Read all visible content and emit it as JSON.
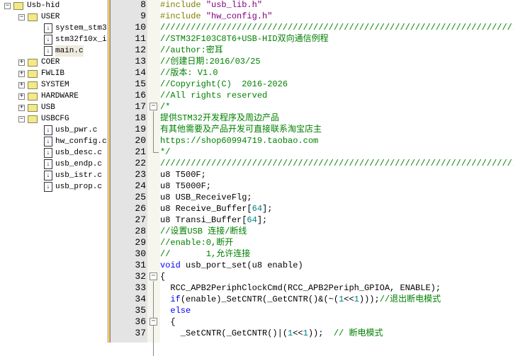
{
  "project_tree": {
    "root": "Usb-hid",
    "groups": [
      {
        "name": "USER",
        "expanded": true,
        "files": [
          "system_stm3",
          "stm32f10x_i",
          "main.c"
        ],
        "selected": "main.c"
      },
      {
        "name": "COER",
        "expanded": false
      },
      {
        "name": "FWLIB",
        "expanded": false
      },
      {
        "name": "SYSTEM",
        "expanded": false
      },
      {
        "name": "HARDWARE",
        "expanded": false
      },
      {
        "name": "USB",
        "expanded": false
      },
      {
        "name": "USBCFG",
        "expanded": true,
        "files": [
          "usb_pwr.c",
          "hw_config.c",
          "usb_desc.c",
          "usb_endp.c",
          "usb_istr.c",
          "usb_prop.c"
        ]
      }
    ]
  },
  "editor": {
    "lines": [
      {
        "n": "8",
        "seg": [
          [
            "#include ",
            "pp"
          ],
          [
            "\"usb_lib.h\"",
            "str"
          ]
        ]
      },
      {
        "n": "9",
        "seg": [
          [
            "#include ",
            "pp"
          ],
          [
            "\"hw_config.h\"",
            "str"
          ]
        ]
      },
      {
        "n": "10",
        "seg": [
          [
            "//////////////////////////////////////////////////////////////////////",
            "cm"
          ]
        ]
      },
      {
        "n": "11",
        "seg": [
          [
            "//STM32F103C8T6+USB-HID双向通信例程",
            "cm"
          ]
        ]
      },
      {
        "n": "12",
        "seg": [
          [
            "//author:密耳",
            "cm"
          ]
        ]
      },
      {
        "n": "13",
        "seg": [
          [
            "//创建日期:2016/03/25",
            "cm"
          ]
        ]
      },
      {
        "n": "14",
        "seg": [
          [
            "//版本: V1.0",
            "cm"
          ]
        ]
      },
      {
        "n": "15",
        "seg": [
          [
            "//Copyright(C)  2016-2026",
            "cm"
          ]
        ]
      },
      {
        "n": "16",
        "seg": [
          [
            "//All rights reserved",
            "cm"
          ]
        ]
      },
      {
        "n": "17",
        "seg": [
          [
            "/*",
            "cm"
          ]
        ],
        "fold": "start"
      },
      {
        "n": "18",
        "seg": [
          [
            "提供STM32开发程序及周边产品",
            "cm"
          ]
        ]
      },
      {
        "n": "19",
        "seg": [
          [
            "有其他需要及产品开发可直接联系淘宝店主",
            "cm"
          ]
        ]
      },
      {
        "n": "20",
        "seg": [
          [
            "https://shop60994719.taobao.com",
            "cm"
          ]
        ]
      },
      {
        "n": "21",
        "seg": [
          [
            "*/",
            "cm"
          ]
        ],
        "fold": "end"
      },
      {
        "n": "22",
        "seg": [
          [
            "//////////////////////////////////////////////////////////////////////",
            "cm"
          ]
        ]
      },
      {
        "n": "23",
        "seg": [
          [
            "u8 T500F;",
            "tx"
          ]
        ]
      },
      {
        "n": "24",
        "seg": [
          [
            "u8 T5000F;",
            "tx"
          ]
        ]
      },
      {
        "n": "25",
        "seg": [
          [
            "u8 USB_ReceiveFlg;",
            "tx"
          ]
        ]
      },
      {
        "n": "26",
        "seg": [
          [
            "u8 Receive_Buffer[",
            "tx"
          ],
          [
            "64",
            "num"
          ],
          [
            "];",
            "tx"
          ]
        ]
      },
      {
        "n": "27",
        "seg": [
          [
            "u8 Transi_Buffer[",
            "tx"
          ],
          [
            "64",
            "num"
          ],
          [
            "];",
            "tx"
          ]
        ]
      },
      {
        "n": "28",
        "seg": [
          [
            "//设置USB 连接/断线",
            "cm"
          ]
        ]
      },
      {
        "n": "29",
        "seg": [
          [
            "//enable:0,断开",
            "cm"
          ]
        ]
      },
      {
        "n": "30",
        "seg": [
          [
            "//       1,允许连接",
            "cm"
          ]
        ]
      },
      {
        "n": "31",
        "seg": [
          [
            "void",
            "kw"
          ],
          [
            " usb_port_set(u8 enable)",
            "tx"
          ]
        ]
      },
      {
        "n": "32",
        "seg": [
          [
            "{",
            "tx"
          ]
        ],
        "fold": "start"
      },
      {
        "n": "33",
        "seg": [
          [
            "  RCC_APB2PeriphClockCmd(RCC_APB2Periph_GPIOA, ENABLE);",
            "tx"
          ]
        ]
      },
      {
        "n": "34",
        "seg": [
          [
            "  ",
            "tx"
          ],
          [
            "if",
            "kw"
          ],
          [
            "(enable)_SetCNTR(_GetCNTR()&(~(",
            "tx"
          ],
          [
            "1",
            "num"
          ],
          [
            "<<",
            "tx"
          ],
          [
            "1",
            "num"
          ],
          [
            ")));",
            "tx"
          ],
          [
            "//退出断电模式",
            "cm"
          ]
        ]
      },
      {
        "n": "35",
        "seg": [
          [
            "  ",
            "tx"
          ],
          [
            "else",
            "kw"
          ]
        ]
      },
      {
        "n": "36",
        "seg": [
          [
            "  {",
            "tx"
          ]
        ],
        "fold": "start"
      },
      {
        "n": "37",
        "seg": [
          [
            "    _SetCNTR(_GetCNTR()|(",
            "tx"
          ],
          [
            "1",
            "num"
          ],
          [
            "<<",
            "tx"
          ],
          [
            "1",
            "num"
          ],
          [
            "));  ",
            "tx"
          ],
          [
            "// 断电模式",
            "cm"
          ]
        ]
      }
    ]
  }
}
